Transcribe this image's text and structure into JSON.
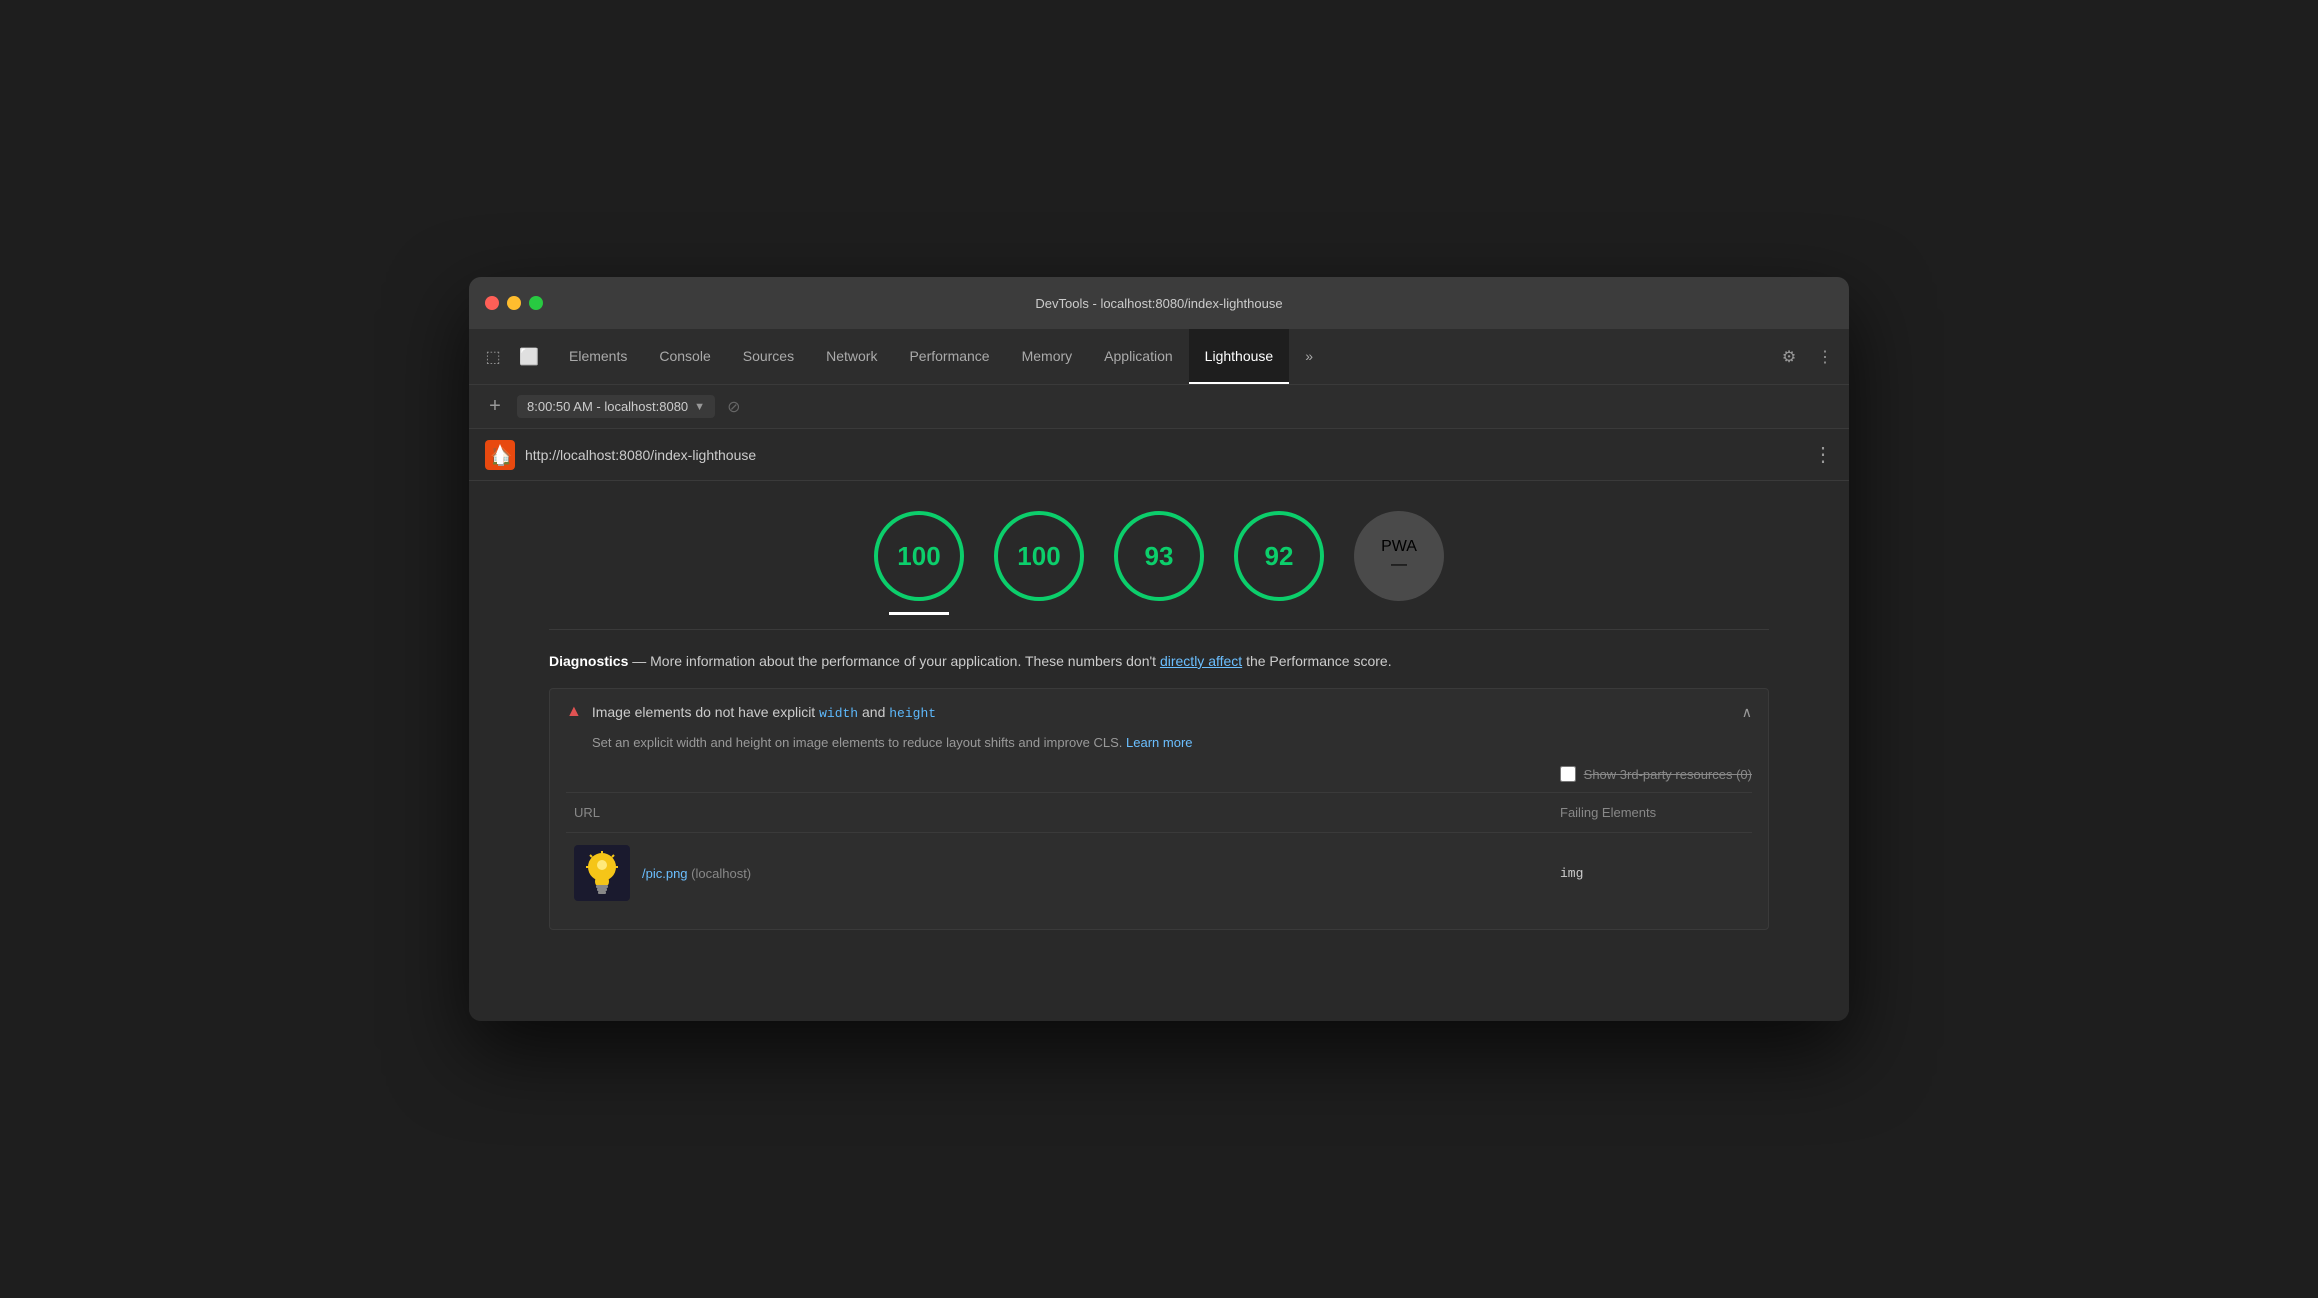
{
  "window": {
    "title": "DevTools - localhost:8080/index-lighthouse"
  },
  "traffic_lights": {
    "red": "red",
    "yellow": "yellow",
    "green": "green"
  },
  "tabs": {
    "items": [
      {
        "label": "Elements",
        "active": false
      },
      {
        "label": "Console",
        "active": false
      },
      {
        "label": "Sources",
        "active": false
      },
      {
        "label": "Network",
        "active": false
      },
      {
        "label": "Performance",
        "active": false
      },
      {
        "label": "Memory",
        "active": false
      },
      {
        "label": "Application",
        "active": false
      },
      {
        "label": "Lighthouse",
        "active": true
      }
    ],
    "more_label": "»"
  },
  "address_bar": {
    "time": "8:00:50 AM - localhost:8080",
    "url": "http://localhost:8080/index-lighthouse"
  },
  "scores": [
    {
      "value": "100",
      "type": "green",
      "active": true
    },
    {
      "value": "100",
      "type": "green",
      "active": false
    },
    {
      "value": "93",
      "type": "green",
      "active": false
    },
    {
      "value": "92",
      "type": "green",
      "active": false
    }
  ],
  "pwa": {
    "label": "PWA",
    "dash": "—"
  },
  "diagnostics": {
    "heading_bold": "Diagnostics",
    "heading_text": " — More information about the performance of your application. These numbers don't ",
    "link_text": "directly affect",
    "heading_end": " the Performance score.",
    "link_url": "#"
  },
  "warning": {
    "title_before": "Image elements do not have explicit ",
    "code1": "width",
    "title_mid": " and ",
    "code2": "height",
    "description_before": "Set an explicit width and height on image elements to reduce layout shifts and improve CLS. ",
    "learn_more": "Learn more",
    "learn_more_url": "#",
    "show_3rd_party_label": "Show 3rd-party resources (0)",
    "table": {
      "headers": [
        "URL",
        "Failing Elements"
      ],
      "rows": [
        {
          "url_link": "/pic.png",
          "url_host": "(localhost)",
          "failing": "img"
        }
      ]
    }
  }
}
